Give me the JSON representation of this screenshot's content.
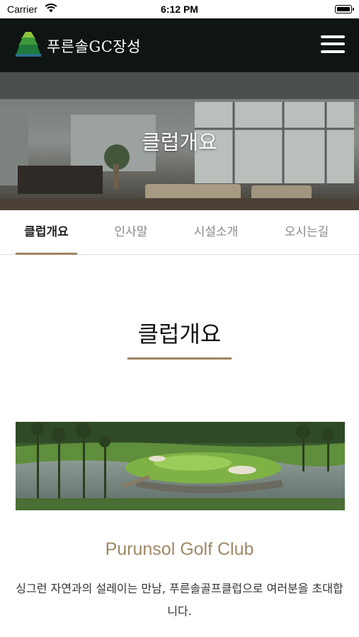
{
  "status_bar": {
    "carrier": "Carrier",
    "time": "6:12 PM"
  },
  "header": {
    "logo_text": "푸른솔GC장성",
    "logo_icon": "pine-tree-logo-icon",
    "menu_icon": "hamburger-menu-icon"
  },
  "hero": {
    "title": "클럽개요"
  },
  "tabs": [
    {
      "label": "클럽개요",
      "active": true
    },
    {
      "label": "인사말",
      "active": false
    },
    {
      "label": "시설소개",
      "active": false
    },
    {
      "label": "오시는길",
      "active": false
    }
  ],
  "content": {
    "section_title": "클럽개요",
    "club_name": "Purunsol Golf Club",
    "intro": "싱그런 자연과의 설레이는 만남, 푸른솔골프클럽으로 여러분을 초대합니다."
  },
  "colors": {
    "accent": "#9c8463",
    "header_bg": "#0e1513",
    "club_name": "#a08866"
  }
}
